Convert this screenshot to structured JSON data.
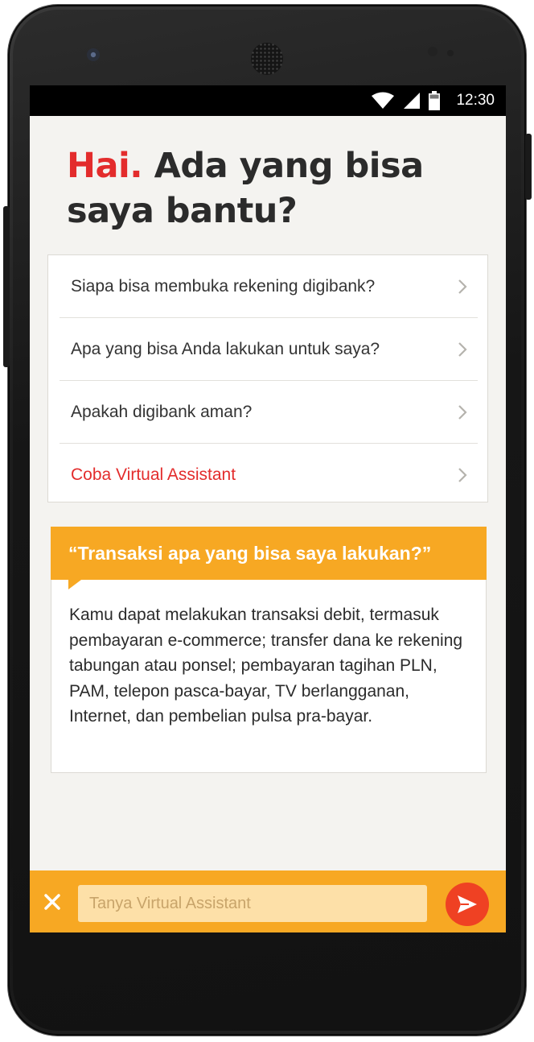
{
  "status_bar": {
    "time": "12:30",
    "icons": [
      "wifi-icon",
      "signal-icon",
      "battery-icon"
    ]
  },
  "headline": {
    "greeting": "Hai.",
    "question": "Ada yang bisa saya bantu?"
  },
  "faq": {
    "items": [
      {
        "label": "Siapa bisa membuka rekening digibank?"
      },
      {
        "label": "Apa yang bisa Anda lakukan untuk saya?"
      },
      {
        "label": "Apakah digibank aman?"
      },
      {
        "label": "Coba Virtual Assistant"
      }
    ]
  },
  "answer": {
    "question": "“Transaksi apa yang bisa saya lakukan?”",
    "body": "Kamu dapat melakukan transaksi debit, termasuk pembayaran e-commerce; transfer dana ke rekening tabungan atau ponsel; pembayaran tagihan PLN, PAM, telepon pasca-bayar, TV berlangganan, Internet, dan pembelian pulsa pra-bayar."
  },
  "input_bar": {
    "placeholder": "Tanya Virtual Assistant"
  },
  "colors": {
    "accent_red": "#e32c2c",
    "orange": "#f7a823",
    "send_red": "#ef4123",
    "background": "#f4f3f0"
  }
}
